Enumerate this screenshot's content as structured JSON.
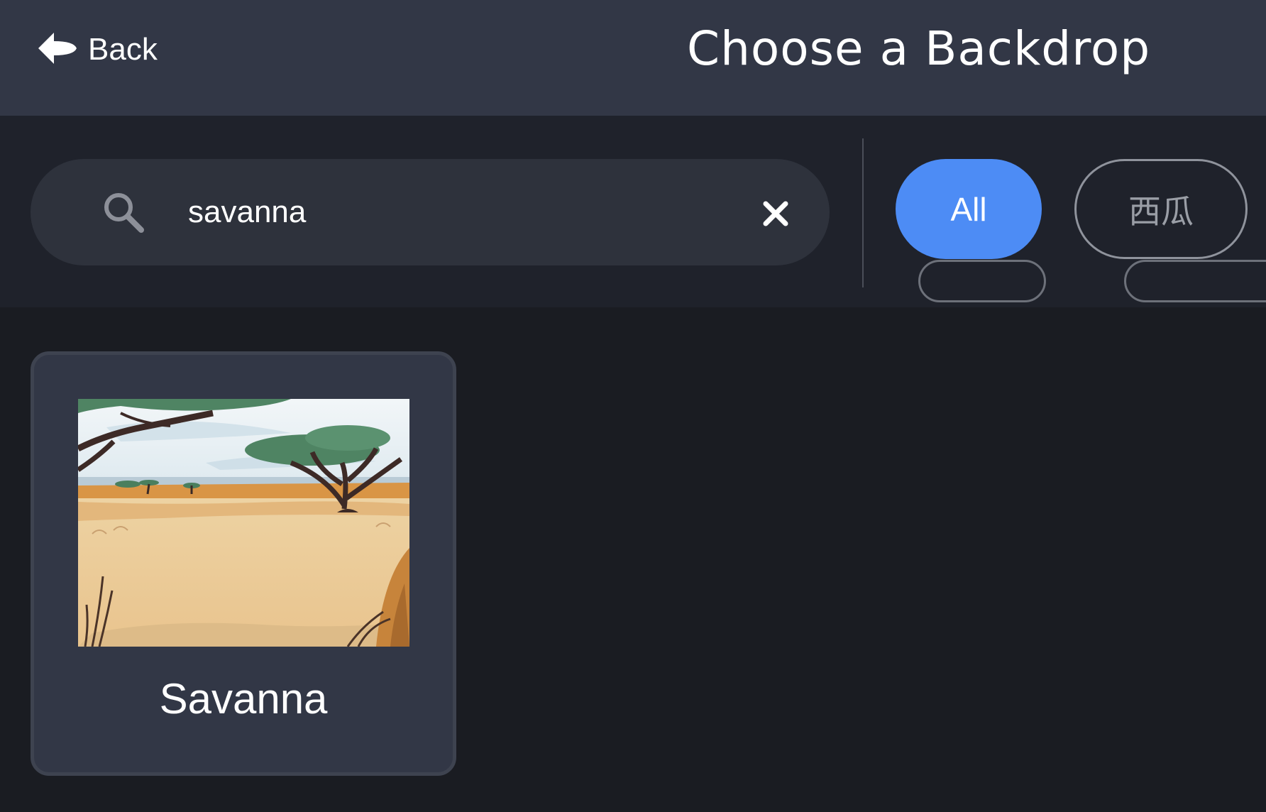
{
  "header": {
    "back_label": "Back",
    "title": "Choose a Backdrop",
    "background": "#323746"
  },
  "search": {
    "value": "savanna",
    "placeholder": "Search"
  },
  "filters": {
    "tabs": [
      {
        "label": "All",
        "selected": true
      },
      {
        "label": "西瓜",
        "selected": false
      }
    ],
    "accent": "#4d8cf5"
  },
  "results": [
    {
      "name": "Savanna",
      "thumbnail": "savanna-landscape-illustration"
    }
  ],
  "icons": {
    "back": "back-arrow-icon",
    "search": "search-icon",
    "clear": "close-icon"
  }
}
